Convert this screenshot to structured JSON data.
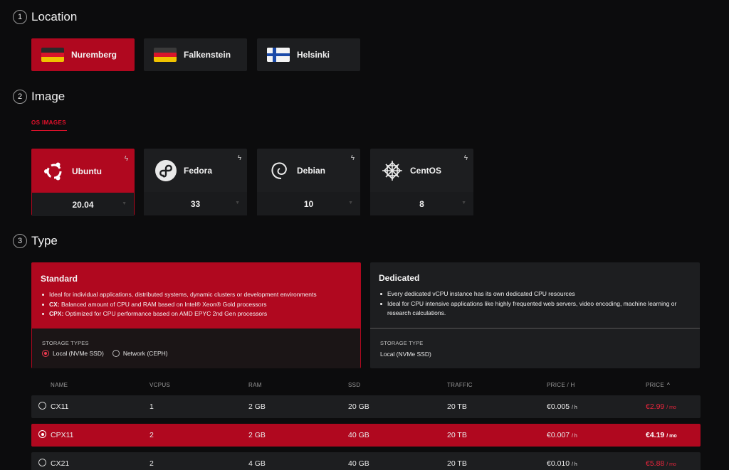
{
  "steps": {
    "location": {
      "num": "1",
      "title": "Location"
    },
    "image": {
      "num": "2",
      "title": "Image"
    },
    "type": {
      "num": "3",
      "title": "Type"
    }
  },
  "locations": [
    {
      "label": "Nuremberg",
      "flag": "germany-flag",
      "selected": true
    },
    {
      "label": "Falkenstein",
      "flag": "germany-flag",
      "selected": false
    },
    {
      "label": "Helsinki",
      "flag": "finland-flag",
      "selected": false
    }
  ],
  "image_tabs": {
    "os_images": "OS IMAGES"
  },
  "images": [
    {
      "label": "Ubuntu",
      "version": "20.04",
      "icon": "ubuntu-logo-icon",
      "selected": true
    },
    {
      "label": "Fedora",
      "version": "33",
      "icon": "fedora-logo-icon",
      "selected": false
    },
    {
      "label": "Debian",
      "version": "10",
      "icon": "debian-logo-icon",
      "selected": false
    },
    {
      "label": "CentOS",
      "version": "8",
      "icon": "centos-logo-icon",
      "selected": false
    }
  ],
  "types": {
    "standard": {
      "title": "Standard",
      "bullets": [
        {
          "bold": "",
          "text": "Ideal for individual applications, distributed systems, dynamic clusters or development environments"
        },
        {
          "bold": "CX:",
          "text": " Balanced amount of CPU and RAM based on Intel® Xeon® Gold processors"
        },
        {
          "bold": "CPX:",
          "text": " Optimized for CPU performance based on AMD EPYC 2nd Gen processors"
        }
      ],
      "storage_label": "STORAGE TYPES",
      "storage_options": [
        {
          "label": "Local (NVMe SSD)",
          "selected": true
        },
        {
          "label": "Network (CEPH)",
          "selected": false
        }
      ]
    },
    "dedicated": {
      "title": "Dedicated",
      "bullets": [
        "Every dedicated vCPU instance has its own dedicated CPU resources",
        "Ideal for CPU intensive applications like highly frequented web servers, video encoding, machine learning or research calculations."
      ],
      "storage_label": "STORAGE TYPE",
      "storage_value": "Local (NVMe SSD)"
    }
  },
  "table": {
    "headers": {
      "name": "NAME",
      "vcpus": "VCPUS",
      "ram": "RAM",
      "ssd": "SSD",
      "traffic": "TRAFFIC",
      "price_h": "PRICE / H",
      "price": "PRICE"
    },
    "rows": [
      {
        "name": "CX11",
        "vcpus": "1",
        "ram": "2 GB",
        "ssd": "20 GB",
        "traffic": "20 TB",
        "price_h": "€0.005",
        "price_h_unit": "/ h",
        "price_mo": "€2.99",
        "price_mo_unit": "/ mo",
        "selected": false
      },
      {
        "name": "CPX11",
        "vcpus": "2",
        "ram": "2 GB",
        "ssd": "40 GB",
        "traffic": "20 TB",
        "price_h": "€0.007",
        "price_h_unit": "/ h",
        "price_mo": "€4.19",
        "price_mo_unit": "/ mo",
        "selected": true
      },
      {
        "name": "CX21",
        "vcpus": "2",
        "ram": "4 GB",
        "ssd": "40 GB",
        "traffic": "20 TB",
        "price_h": "€0.010",
        "price_h_unit": "/ h",
        "price_mo": "€5.88",
        "price_mo_unit": "/ mo",
        "selected": false
      }
    ]
  },
  "colors": {
    "accent": "#b0081f",
    "accent_text": "#e8253c",
    "card_bg": "#1d1e20",
    "page_bg": "#0c0c0d"
  }
}
